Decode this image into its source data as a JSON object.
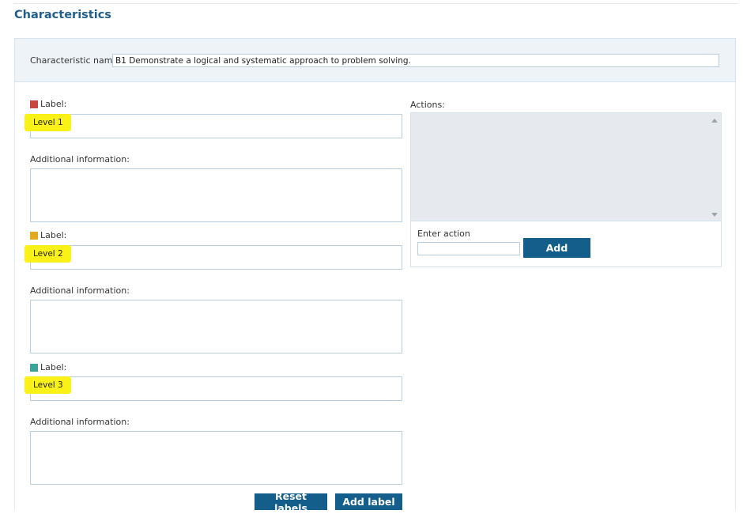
{
  "page": {
    "title": "Characteristics"
  },
  "characteristic": {
    "name_label": "Characteristic name:",
    "name_value": "B1 Demonstrate a logical and systematic approach to problem solving."
  },
  "labels": [
    {
      "caption": "Label:",
      "value": "Level 1",
      "color": "#c8463f",
      "info_caption": "Additional information:",
      "info_value": ""
    },
    {
      "caption": "Label:",
      "value": "Level 2",
      "color": "#e3a91c",
      "info_caption": "Additional information:",
      "info_value": ""
    },
    {
      "caption": "Label:",
      "value": "Level 3",
      "color": "#3aa39a",
      "info_caption": "Additional information:",
      "info_value": ""
    }
  ],
  "actions": {
    "caption": "Actions:",
    "enter_label": "Enter action",
    "enter_value": "",
    "add_label": "Add"
  },
  "buttons": {
    "reset": "Reset labels",
    "add_label": "Add label"
  },
  "colors": {
    "accent": "#145e8c",
    "title": "#1f5f8f",
    "highlight": "#f9f00b"
  }
}
